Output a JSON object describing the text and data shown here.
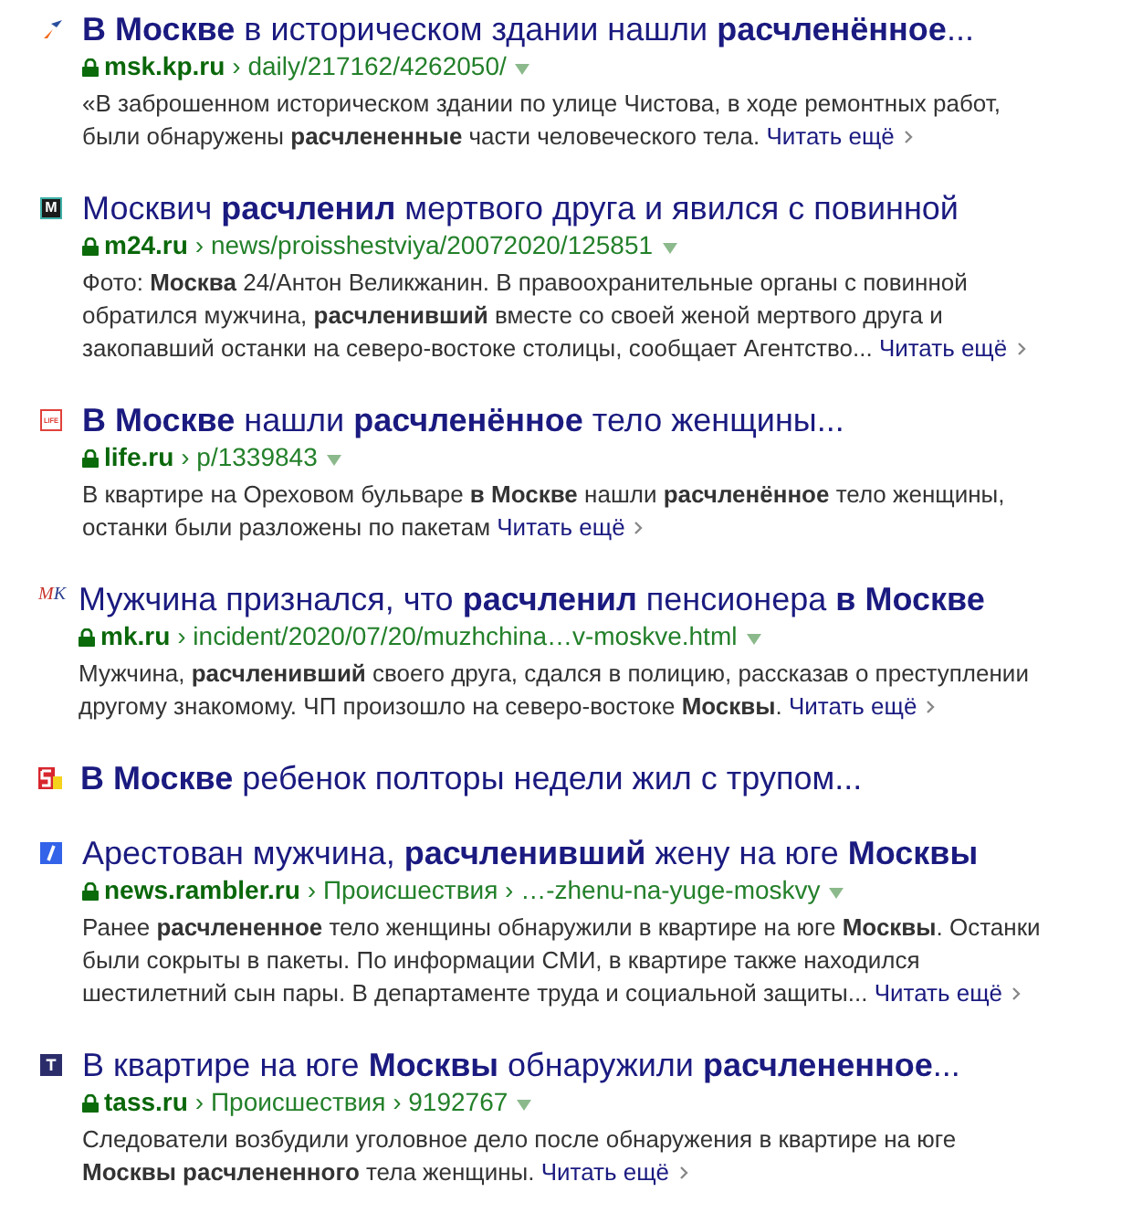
{
  "results": [
    {
      "favicon": {
        "kind": "swoosh"
      },
      "title": "**В Москве** в историческом здании нашли **расчленённое**...",
      "domain": "msk.kp.ru",
      "path": "› daily/217162/4262050/",
      "snippet": "«В заброшенном историческом здании по улице Чистова, в ходе ремонтных работ, были обнаружены **расчлененные** части человеческого тела.",
      "more": "Читать ещё"
    },
    {
      "favicon": {
        "kind": "boxed",
        "letters": "M"
      },
      "title": "Москвич **расчленил** мертвого друга и явился с повинной",
      "domain": "m24.ru",
      "path": "› news/proisshestviya/20072020/125851",
      "snippet": "Фото: **Москва** 24/Антон Великжанин. В правоохранительные органы с повинной обратился мужчина, **расчленивший** вместе со своей женой мертвого друга и закопавший останки на северо-востоке столицы, сообщает Агентство...",
      "more": "Читать ещё"
    },
    {
      "favicon": {
        "kind": "framed",
        "letters": "LIFE"
      },
      "title": "**В Москве** нашли **расчленённое** тело женщины...",
      "domain": "life.ru",
      "path": "› p/1339843",
      "snippet": "В квартире на Ореховом бульваре **в Москве** нашли **расчленённое** тело женщины, останки были разложены по пакетам",
      "more": "Читать ещё"
    },
    {
      "favicon": {
        "kind": "italic",
        "letters": "MK"
      },
      "title": "Мужчина признался, что **расчленил** пенсионера **в Москве**",
      "domain": "mk.ru",
      "path": "› incident/2020/07/20/muzhchina…v-moskve.html",
      "snippet": "Мужчина, **расчленивший** своего друга, сдался в полицию, рассказав о преступлении другому знакомому. ЧП произошло на северо-востоке **Москвы**.",
      "more": "Читать ещё"
    },
    {
      "favicon": {
        "kind": "split"
      },
      "title": "**В Москве** ребенок полторы недели жил с трупом..."
    },
    {
      "favicon": {
        "kind": "slash"
      },
      "title": "Арестован мужчина, **расчленивший** жену на юге **Москвы**",
      "domain": "news.rambler.ru",
      "path": "› Происшествия › …-zhenu-na-yuge-moskvy",
      "snippet": "Ранее **расчлененное** тело женщины обнаружили в квартире на юге **Москвы**. Останки были сокрыты в пакеты. По информации СМИ, в квартире также находился шестилетний сын пары. В департаменте труда и социальной защиты...",
      "more": "Читать ещё"
    },
    {
      "favicon": {
        "kind": "tile",
        "letters": "T"
      },
      "title": "В квартире на юге **Москвы** обнаружили **расчлененное**...",
      "domain": "tass.ru",
      "path": "› Происшествия › 9192767",
      "snippet": "Следователи возбудили уголовное дело после обнаружения в квартире на юге **Москвы расчлененного** тела женщины.",
      "more": "Читать ещё"
    }
  ]
}
